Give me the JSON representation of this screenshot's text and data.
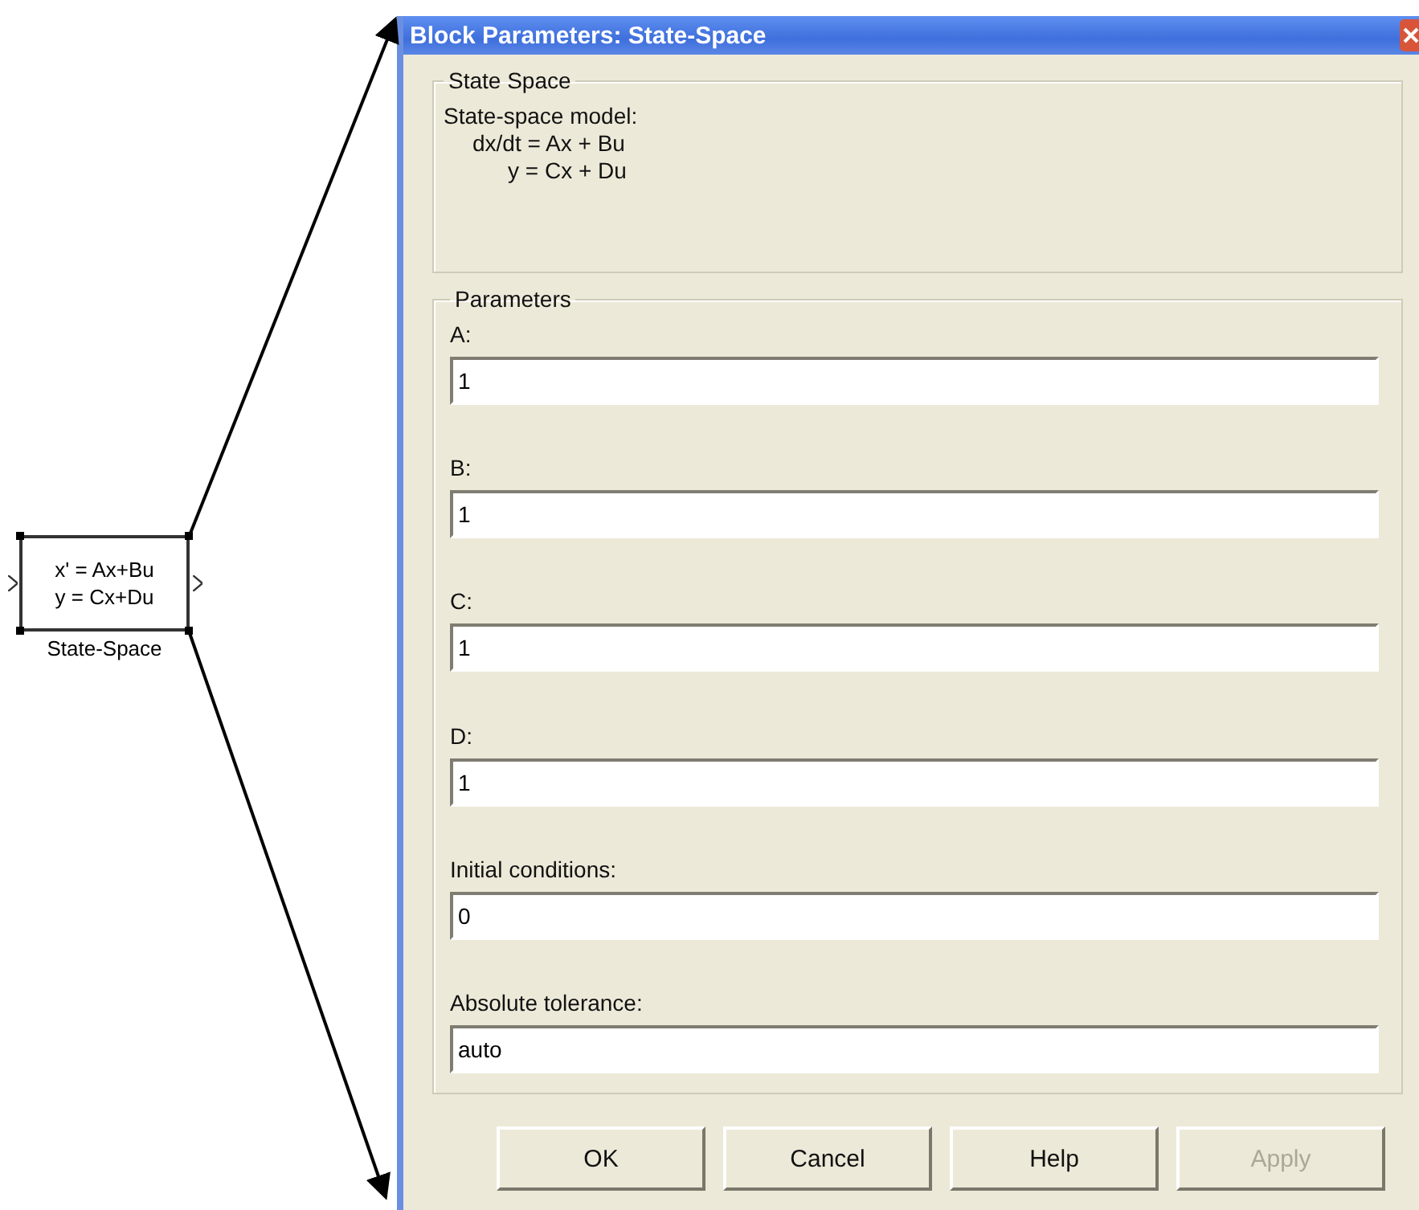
{
  "canvas": {
    "block": {
      "lines": [
        "x' = Ax+Bu",
        "y = Cx+Du"
      ],
      "name": "State-Space"
    }
  },
  "dialog": {
    "title": "Block Parameters: State-Space",
    "description": {
      "legend": "State Space",
      "lines": [
        "State-space model:",
        "dx/dt = Ax + Bu",
        "y = Cx + Du"
      ]
    },
    "parameters": {
      "legend": "Parameters",
      "fields": [
        {
          "label": "A:",
          "value": "1"
        },
        {
          "label": "B:",
          "value": "1"
        },
        {
          "label": "C:",
          "value": "1"
        },
        {
          "label": "D:",
          "value": "1"
        },
        {
          "label": "Initial conditions:",
          "value": "0"
        },
        {
          "label": "Absolute tolerance:",
          "value": "auto"
        }
      ]
    },
    "buttons": [
      {
        "label": "OK",
        "disabled": false
      },
      {
        "label": "Cancel",
        "disabled": false
      },
      {
        "label": "Help",
        "disabled": false
      },
      {
        "label": "Apply",
        "disabled": true
      }
    ]
  }
}
